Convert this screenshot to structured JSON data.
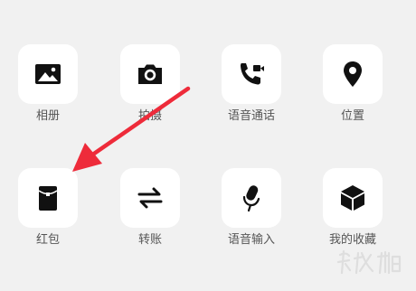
{
  "panel": {
    "items": [
      {
        "label": "相册",
        "icon": "photo-album-icon"
      },
      {
        "label": "拍摄",
        "icon": "camera-icon"
      },
      {
        "label": "语音通话",
        "icon": "voice-call-icon"
      },
      {
        "label": "位置",
        "icon": "location-icon"
      },
      {
        "label": "红包",
        "icon": "red-packet-icon"
      },
      {
        "label": "转账",
        "icon": "transfer-icon"
      },
      {
        "label": "语音输入",
        "icon": "microphone-icon"
      },
      {
        "label": "我的收藏",
        "icon": "favorites-cube-icon"
      }
    ]
  },
  "annotation": {
    "arrow_color": "#ee2b3a",
    "arrow_target": "红包"
  },
  "colors": {
    "background": "#f1f1f1",
    "tile": "#ffffff",
    "icon": "#111111",
    "label": "#555555"
  }
}
